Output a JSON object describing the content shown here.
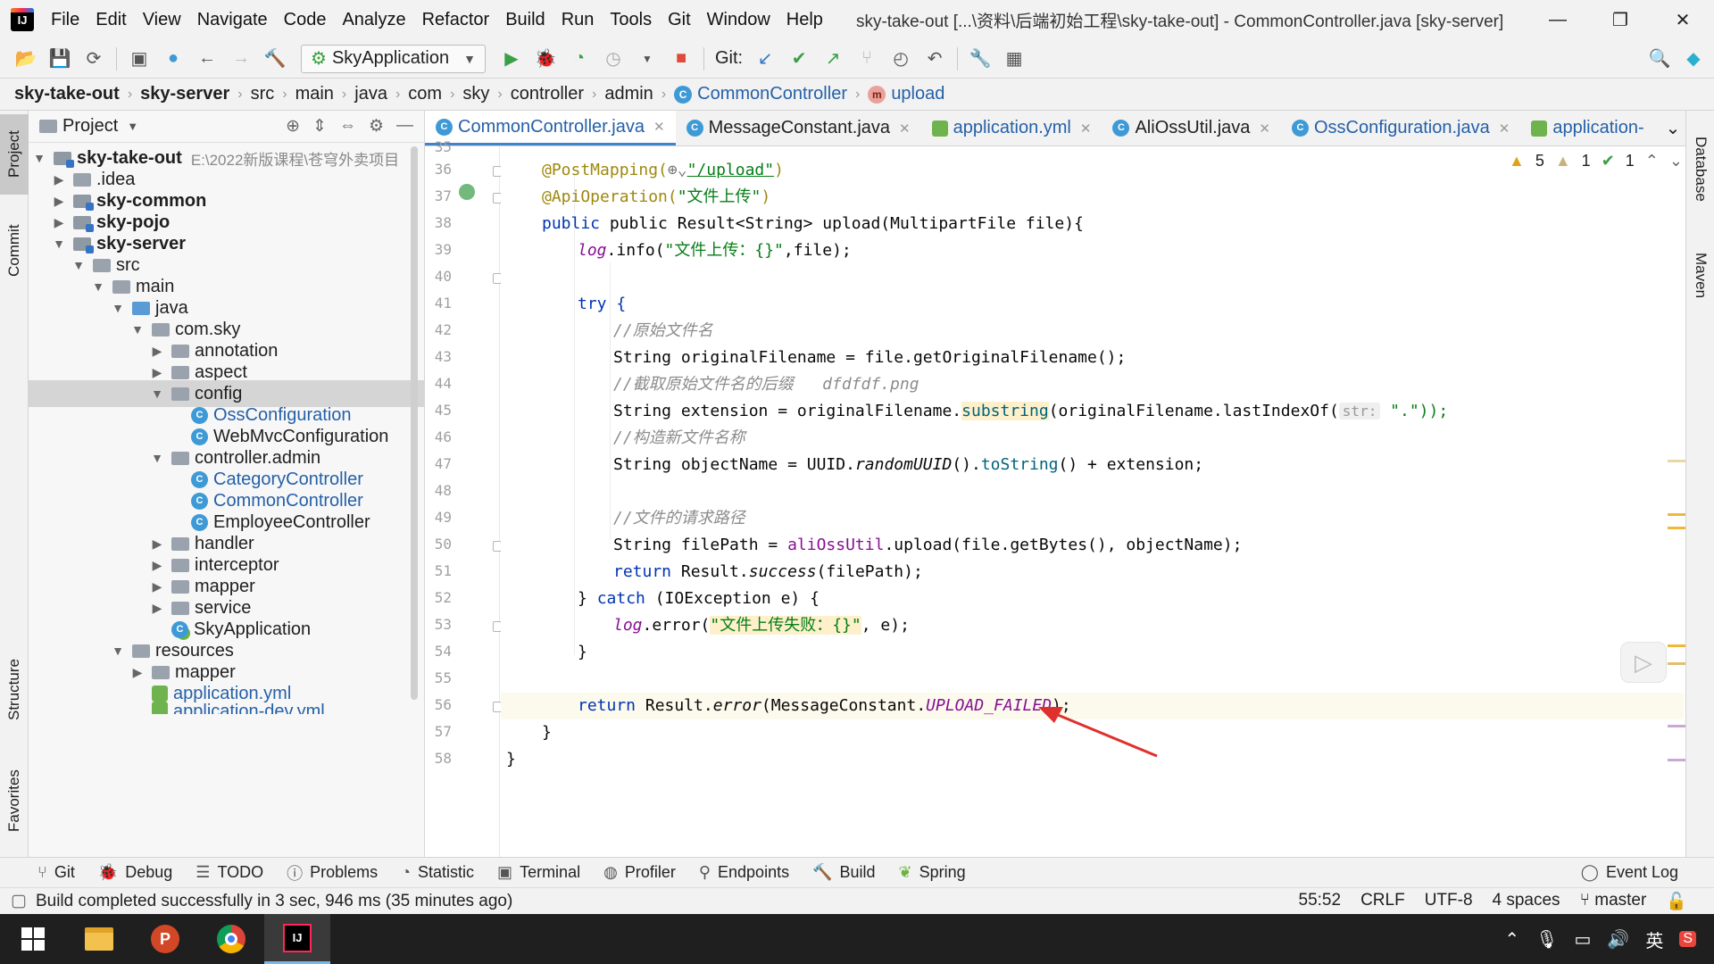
{
  "window": {
    "title": "sky-take-out [...\\资料\\后端初始工程\\sky-take-out] - CommonController.java [sky-server]",
    "menu": [
      "File",
      "Edit",
      "View",
      "Navigate",
      "Code",
      "Analyze",
      "Refactor",
      "Build",
      "Run",
      "Tools",
      "Git",
      "Window",
      "Help"
    ],
    "controls": {
      "minimize": "—",
      "restore": "❐",
      "close": "✕"
    }
  },
  "toolbar": {
    "run_config": "SkyApplication",
    "git_label": "Git:"
  },
  "breadcrumb": [
    "sky-take-out",
    "sky-server",
    "src",
    "main",
    "java",
    "com",
    "sky",
    "controller",
    "admin",
    "CommonController",
    "upload"
  ],
  "left_strip": {
    "project": "Project",
    "commit": "Commit",
    "structure": "Structure",
    "favorites": "Favorites"
  },
  "right_strip": {
    "database": "Database",
    "maven": "Maven"
  },
  "project": {
    "title": "Project",
    "root_path": "E:\\2022新版课程\\苍穹外卖项目",
    "tree": [
      {
        "label": "sky-take-out",
        "bold": true
      },
      {
        "label": ".idea"
      },
      {
        "label": "sky-common",
        "bold": true
      },
      {
        "label": "sky-pojo",
        "bold": true
      },
      {
        "label": "sky-server",
        "bold": true
      },
      {
        "label": "src"
      },
      {
        "label": "main"
      },
      {
        "label": "java"
      },
      {
        "label": "com.sky"
      },
      {
        "label": "annotation"
      },
      {
        "label": "aspect"
      },
      {
        "label": "config"
      },
      {
        "label": "OssConfiguration"
      },
      {
        "label": "WebMvcConfiguration"
      },
      {
        "label": "controller.admin"
      },
      {
        "label": "CategoryController"
      },
      {
        "label": "CommonController"
      },
      {
        "label": "EmployeeController"
      },
      {
        "label": "handler"
      },
      {
        "label": "interceptor"
      },
      {
        "label": "mapper"
      },
      {
        "label": "service"
      },
      {
        "label": "SkyApplication"
      },
      {
        "label": "resources"
      },
      {
        "label": "mapper"
      },
      {
        "label": "application.yml"
      },
      {
        "label": "application-dev.yml"
      }
    ]
  },
  "editor_tabs": [
    "CommonController.java",
    "MessageConstant.java",
    "application.yml",
    "AliOssUtil.java",
    "OssConfiguration.java",
    "application-"
  ],
  "inspections": {
    "warnings": "5",
    "weak_warnings": "1",
    "ok": "1"
  },
  "line_numbers": [
    "35",
    "36",
    "37",
    "38",
    "39",
    "40",
    "41",
    "42",
    "43",
    "44",
    "45",
    "46",
    "47",
    "48",
    "49",
    "50",
    "51",
    "52",
    "53",
    "54",
    "55",
    "56",
    "57",
    "58"
  ],
  "code": {
    "l35_ann": "@PostMapping(",
    "l35_path": "\"/upload\"",
    "l35_end": ")",
    "l36_ann": "@ApiOperation(",
    "l36_str": "\"文件上传\"",
    "l36_end": ")",
    "l37": "public Result<String> upload(MultipartFile file){",
    "l38_a": "log",
    "l38_b": ".info(",
    "l38_s": "\"文件上传：{}\"",
    "l38_c": ",file);",
    "l40": "try {",
    "l41": "//原始文件名",
    "l42": "String originalFilename = file.getOriginalFilename();",
    "l43": "//截取原始文件名的后缀   dfdfdf.png",
    "l44_a": "String extension = originalFilename.",
    "l44_b": "substring",
    "l44_c": "(originalFilename.lastIndexOf(",
    "l44_hint": "str:",
    "l44_d": " \".\"));",
    "l45": "//构造新文件名称",
    "l46_a": "String objectName = UUID.",
    "l46_b": "randomUUID",
    "l46_c": "().",
    "l46_d": "toString",
    "l46_e": "() + extension;",
    "l48": "//文件的请求路径",
    "l49_a": "String filePath = ",
    "l49_b": "aliOssUtil",
    "l49_c": ".upload(file.getBytes(), objectName);",
    "l50_a": "return",
    "l50_b": " Result.",
    "l50_c": "success",
    "l50_d": "(filePath);",
    "l51_a": "} ",
    "l51_b": "catch",
    "l51_c": " (IOException e) {",
    "l52_a": "log",
    "l52_b": ".error(",
    "l52_s": "\"文件上传失败：{}\"",
    "l52_c": ", e);",
    "l53": "}",
    "l55_a": "return",
    "l55_b": " Result.",
    "l55_c": "error",
    "l55_d": "(MessageConstant.",
    "l55_e": "UPLOAD_FAILED",
    "l55_f": ");",
    "l56": "}",
    "l57": "}"
  },
  "bottom_tabs": [
    "Git",
    "Debug",
    "TODO",
    "Problems",
    "Statistic",
    "Terminal",
    "Profiler",
    "Endpoints",
    "Build",
    "Spring"
  ],
  "event_log": "Event Log",
  "status": {
    "message": "Build completed successfully in 3 sec, 946 ms (35 minutes ago)",
    "position": "55:52",
    "line_sep": "CRLF",
    "encoding": "UTF-8",
    "indent": "4 spaces",
    "branch": "master"
  },
  "taskbar": {
    "ime": "英"
  },
  "colors": {
    "accent": "#4083c9",
    "annotation_arrow": "#e0302e"
  }
}
